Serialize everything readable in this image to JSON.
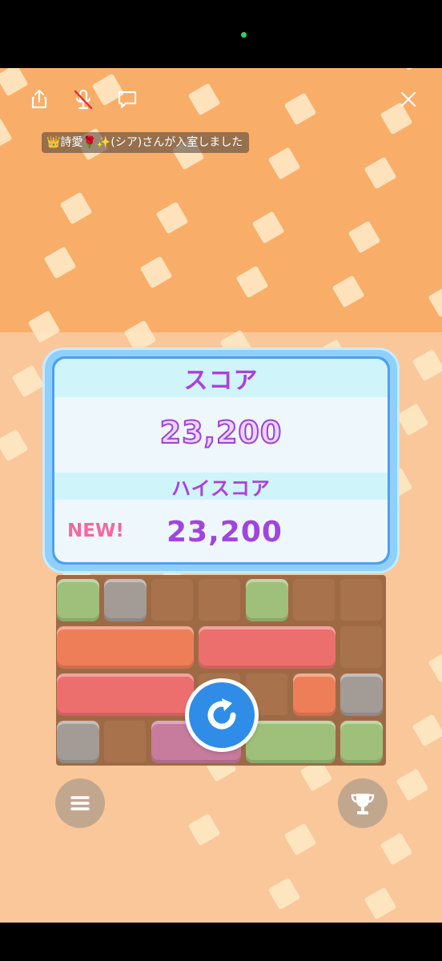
{
  "toast": {
    "join_message": "👑詩愛🌹✨(シア)さんが入室しました"
  },
  "score_panel": {
    "score_label": "スコア",
    "score_value": "23,200",
    "hiscore_label": "ハイスコア",
    "new_badge": "NEW!",
    "hiscore_value": "23,200"
  },
  "icons": {
    "share": "share-icon",
    "mic_muted": "mic-off-icon",
    "comment": "comment-icon",
    "close": "close-icon",
    "restart": "restart-icon",
    "menu": "menu-icon",
    "trophy": "trophy-icon"
  },
  "colors": {
    "top_band": "#f8ad69",
    "bottom_area": "#f9c79a",
    "score_label": "#b03ee0",
    "new_badge": "#f5689f",
    "restart_button": "#2f8de7"
  }
}
